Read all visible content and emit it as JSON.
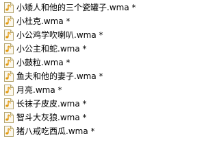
{
  "files": [
    {
      "name": "小矮人和他的三个瓷罐子.wma *",
      "icon": "audio-file-icon"
    },
    {
      "name": "小杜克.wma *",
      "icon": "audio-file-icon"
    },
    {
      "name": "小公鸡学吹喇叭.wma *",
      "icon": "audio-file-icon"
    },
    {
      "name": "小公主和蛇.wma *",
      "icon": "audio-file-icon"
    },
    {
      "name": "小鼓粒.wma *",
      "icon": "audio-file-icon"
    },
    {
      "name": "鱼夫和他的妻子.wma *",
      "icon": "audio-file-icon"
    },
    {
      "name": "月亮.wma *",
      "icon": "audio-file-icon"
    },
    {
      "name": "长袜子皮皮.wma *",
      "icon": "audio-file-icon"
    },
    {
      "name": "智斗大灰狼.wma *",
      "icon": "audio-file-icon"
    },
    {
      "name": "猪八戒吃西瓜.wma *",
      "icon": "audio-file-icon"
    }
  ],
  "colors": {
    "icon_page": "#fbf8ee",
    "icon_border": "#b5a56e",
    "icon_note": "#e39a10",
    "icon_fold": "#e9dfbc"
  }
}
